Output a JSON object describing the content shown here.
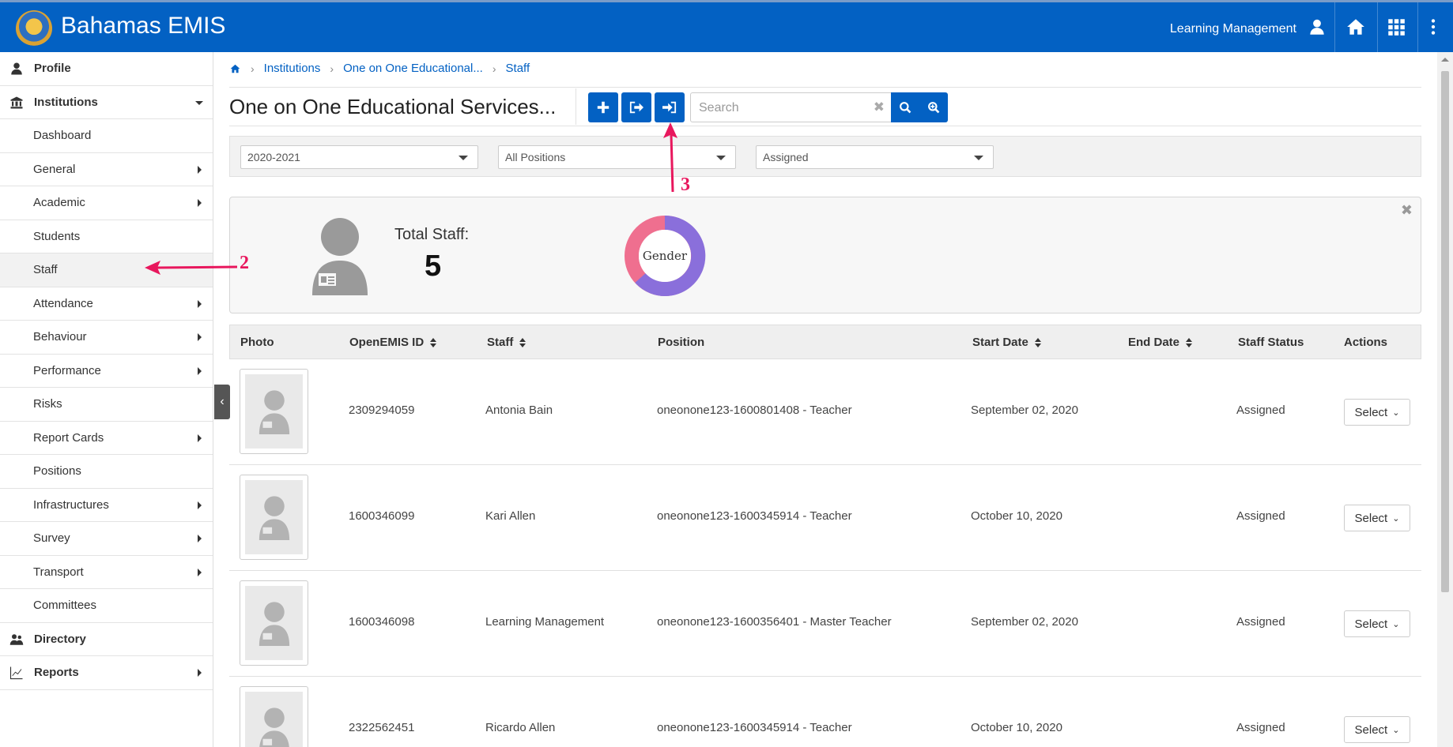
{
  "header": {
    "app_title": "Bahamas EMIS",
    "user_name": "Learning Management",
    "icons": [
      "user-icon",
      "home-icon",
      "apps-grid-icon",
      "more-vertical-icon"
    ]
  },
  "sidebar": {
    "items": [
      {
        "label": "Profile",
        "icon": "user-icon",
        "level": "top"
      },
      {
        "label": "Institutions",
        "icon": "bank-icon",
        "level": "top",
        "expanded": true
      },
      {
        "label": "Dashboard",
        "level": "sub"
      },
      {
        "label": "General",
        "level": "sub",
        "has_children": true
      },
      {
        "label": "Academic",
        "level": "sub",
        "has_children": true
      },
      {
        "label": "Students",
        "level": "sub"
      },
      {
        "label": "Staff",
        "level": "sub",
        "active": true
      },
      {
        "label": "Attendance",
        "level": "sub",
        "has_children": true
      },
      {
        "label": "Behaviour",
        "level": "sub",
        "has_children": true
      },
      {
        "label": "Performance",
        "level": "sub",
        "has_children": true
      },
      {
        "label": "Risks",
        "level": "sub"
      },
      {
        "label": "Report Cards",
        "level": "sub",
        "has_children": true
      },
      {
        "label": "Positions",
        "level": "sub"
      },
      {
        "label": "Infrastructures",
        "level": "sub",
        "has_children": true
      },
      {
        "label": "Survey",
        "level": "sub",
        "has_children": true
      },
      {
        "label": "Transport",
        "level": "sub",
        "has_children": true
      },
      {
        "label": "Committees",
        "level": "sub"
      },
      {
        "label": "Directory",
        "icon": "users-icon",
        "level": "top"
      },
      {
        "label": "Reports",
        "icon": "line-chart-icon",
        "level": "top",
        "has_children": true
      }
    ]
  },
  "breadcrumb": {
    "items": [
      "Institutions",
      "One on One Educational...",
      "Staff"
    ]
  },
  "page": {
    "title": "One on One Educational Services..."
  },
  "toolbar": {
    "add_icon": "plus-icon",
    "export_icon": "export-icon",
    "import_icon": "import-icon",
    "search_placeholder": "Search",
    "search_icon": "search-icon",
    "advanced_search_icon": "zoom-plus-icon"
  },
  "filters": {
    "academic_period": "2020-2021",
    "position": "All Positions",
    "status": "Assigned"
  },
  "overview": {
    "total_label": "Total Staff:",
    "total_value": "5",
    "donut_label": "Gender"
  },
  "table": {
    "headers": {
      "photo": "Photo",
      "openemis_id": "OpenEMIS ID",
      "staff": "Staff",
      "position": "Position",
      "start_date": "Start Date",
      "end_date": "End Date",
      "staff_status": "Staff Status",
      "actions": "Actions"
    },
    "rows": [
      {
        "id": "2309294059",
        "name": "Antonia Bain",
        "position": "oneonone123-1600801408 - Teacher",
        "start": "September 02, 2020",
        "end": "",
        "status": "Assigned",
        "action": "Select"
      },
      {
        "id": "1600346099",
        "name": "Kari Allen",
        "position": "oneonone123-1600345914 - Teacher",
        "start": "October 10, 2020",
        "end": "",
        "status": "Assigned",
        "action": "Select"
      },
      {
        "id": "1600346098",
        "name": "Learning Management",
        "position": "oneonone123-1600356401 - Master Teacher",
        "start": "September 02, 2020",
        "end": "",
        "status": "Assigned",
        "action": "Select"
      },
      {
        "id": "2322562451",
        "name": "Ricardo Allen",
        "position": "oneonone123-1600345914 - Teacher",
        "start": "October 10, 2020",
        "end": "",
        "status": "Assigned",
        "action": "Select"
      }
    ]
  },
  "annotations": {
    "sidebar_marker": "2",
    "toolbar_marker": "3"
  },
  "colors": {
    "brand_blue": "#0361c3",
    "annotation_pink": "#e8175d",
    "donut_female": "#ef6f8f",
    "donut_male": "#8a6fdb"
  }
}
